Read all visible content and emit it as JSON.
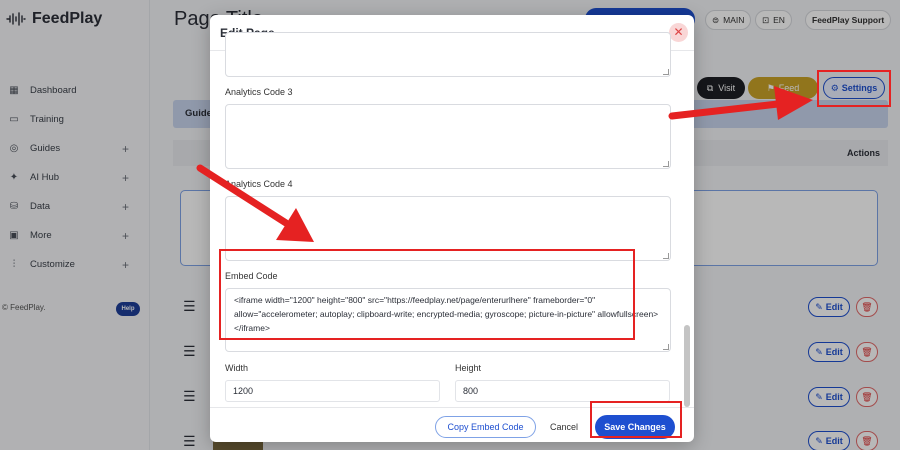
{
  "app": {
    "brand": "FeedPlay",
    "page_title": "Page Title",
    "sidebar": {
      "items": [
        {
          "label": "Dashboard",
          "icon": "grid-icon",
          "expandable": false
        },
        {
          "label": "Training",
          "icon": "book-icon",
          "expandable": false
        },
        {
          "label": "Guides",
          "icon": "compass-icon",
          "expandable": true
        },
        {
          "label": "AI Hub",
          "icon": "magic-icon",
          "expandable": true
        },
        {
          "label": "Data",
          "icon": "database-icon",
          "expandable": true
        },
        {
          "label": "More",
          "icon": "bag-icon",
          "expandable": true
        },
        {
          "label": "Customize",
          "icon": "sliders-icon",
          "expandable": true
        }
      ],
      "footer": "© FeedPlay.",
      "help": "Help"
    },
    "topbar": {
      "main_label": "MAIN",
      "lang_label": "EN",
      "support_label": "FeedPlay Support"
    },
    "actions": {
      "visit_label": "Visit",
      "feed_label": "Feed",
      "settings_label": "Settings"
    },
    "tab_label": "Guide",
    "table_actions_header": "Actions",
    "row_edit_label": "Edit"
  },
  "modal": {
    "title": "Edit Page",
    "fields": {
      "analytics3_label": "Analytics Code 3",
      "analytics4_label": "Analytics Code 4",
      "embed_label": "Embed Code",
      "embed_value": "<iframe width=\"1200\" height=\"800\" src=\"https://feedplay.net/page/enterurlhere\" frameborder=\"0\" allow=\"accelerometer; autoplay; clipboard-write; encrypted-media; gyroscope; picture-in-picture\" allowfullscreen></iframe>",
      "width_label": "Width",
      "width_value": "1200",
      "height_label": "Height",
      "height_value": "800"
    },
    "buttons": {
      "copy_label": "Copy Embed Code",
      "cancel_label": "Cancel",
      "save_label": "Save Changes"
    }
  },
  "colors": {
    "accent": "#1e4fd0",
    "highlight": "#e52222",
    "feed_button": "#c9a227"
  }
}
